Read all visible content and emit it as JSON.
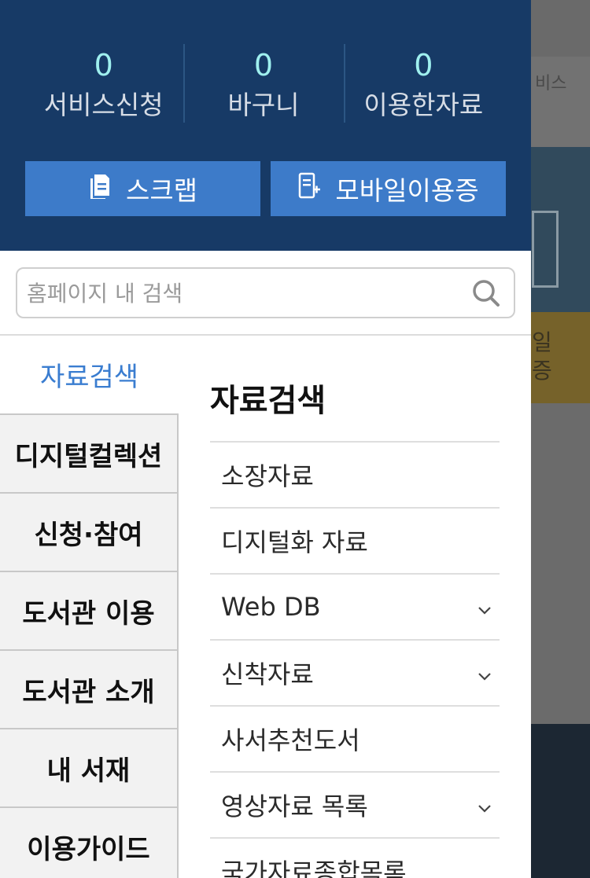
{
  "background": {
    "services_fragment": "비스",
    "banner_fragment": "일\n증"
  },
  "stats": [
    {
      "count": "0",
      "label": "서비스신청"
    },
    {
      "count": "0",
      "label": "바구니"
    },
    {
      "count": "0",
      "label": "이용한자료"
    }
  ],
  "buttons": {
    "scrap": "스크랩",
    "mobile_card": "모바일이용증"
  },
  "search": {
    "placeholder": "홈페이지 내 검색"
  },
  "menu": {
    "items": [
      {
        "label": "자료검색",
        "active": true
      },
      {
        "label": "디지털컬렉션"
      },
      {
        "label": "신청·참여"
      },
      {
        "label": "도서관 이용"
      },
      {
        "label": "도서관 소개"
      },
      {
        "label": "내 서재"
      },
      {
        "label": "이용가이드"
      }
    ]
  },
  "submenu": {
    "title": "자료검색",
    "items": [
      {
        "label": "소장자료",
        "expandable": false
      },
      {
        "label": "디지털화 자료",
        "expandable": false
      },
      {
        "label": "Web DB",
        "expandable": true
      },
      {
        "label": "신착자료",
        "expandable": true
      },
      {
        "label": "사서추천도서",
        "expandable": false
      },
      {
        "label": "영상자료 목록",
        "expandable": true
      },
      {
        "label": "국가자료종합목록",
        "expandable": false
      }
    ]
  },
  "colors": {
    "header_bg": "#173a66",
    "button_bg": "#3d7bc9",
    "stat_count": "#9ff0ef",
    "active_menu": "#3a7dd0"
  }
}
